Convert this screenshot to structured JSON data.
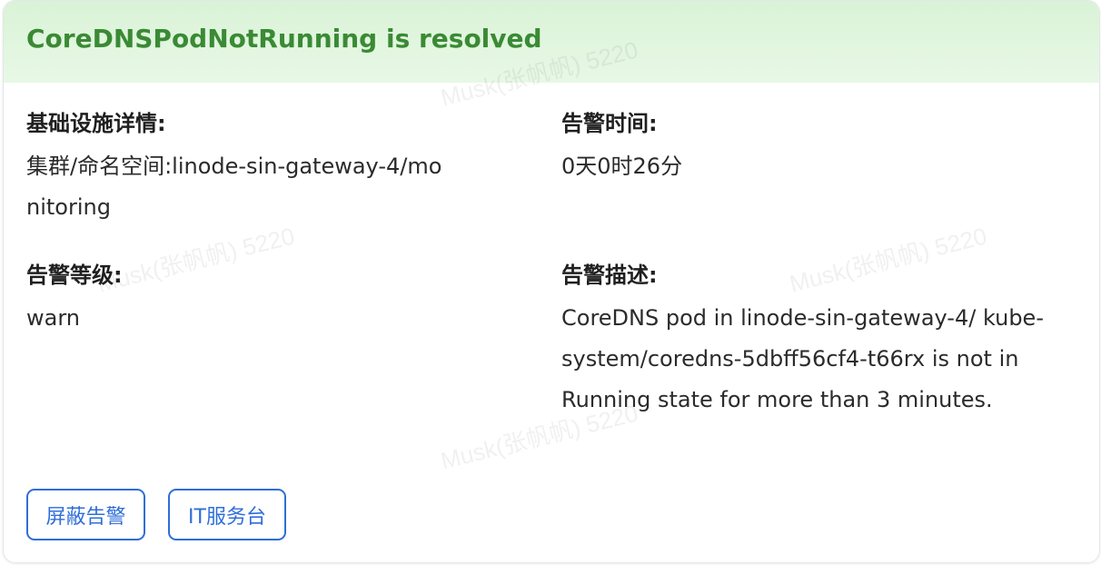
{
  "card": {
    "title": "CoreDNSPodNotRunning is resolved",
    "status_color": "#3a8a34",
    "header_bg": "#d9f3d7"
  },
  "fields": {
    "infra": {
      "label": "基础设施详情:",
      "value": "集群/命名空间:linode-sin-gateway-4/monitoring"
    },
    "time": {
      "label": "告警时间:",
      "value": "0天0时26分"
    },
    "level": {
      "label": "告警等级:",
      "value": "warn"
    },
    "desc": {
      "label": "告警描述:",
      "value": "CoreDNS pod in  linode-sin-gateway-4/ kube-system/coredns-5dbff56cf4-t66rx is not in Running state for more than 3 minutes."
    }
  },
  "actions": {
    "mute_label": "屏蔽告警",
    "it_label": "IT服务台",
    "accent": "#2f6ed8"
  },
  "watermark": {
    "text": "Musk(张帆帆) 5220"
  }
}
